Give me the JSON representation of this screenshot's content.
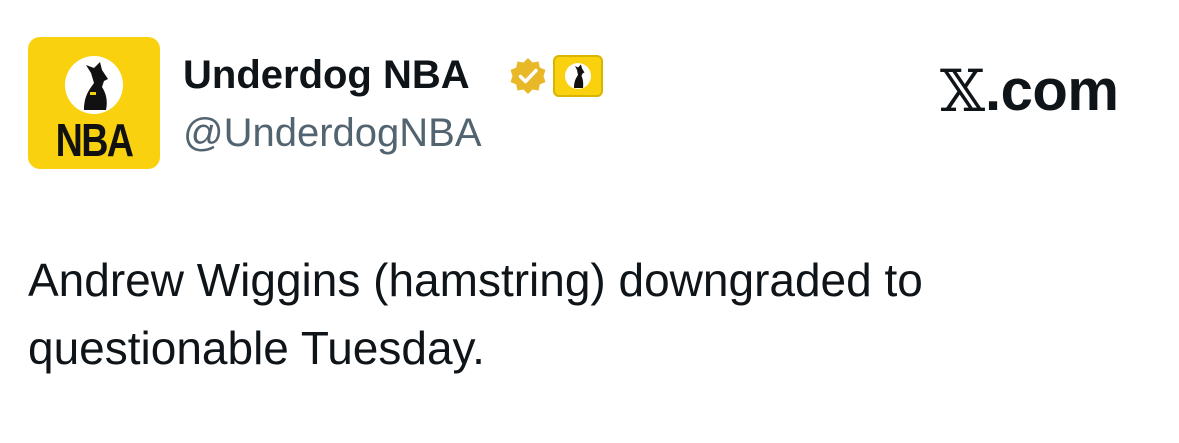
{
  "author": {
    "avatar_text": "NBA",
    "display_name": "Underdog NBA",
    "handle": "@UnderdogNBA",
    "verified_badge": "gold-check-badge-icon",
    "affiliate_badge": "underdog-dog-icon"
  },
  "brand": {
    "logo_x": "𝕏",
    "logo_suffix": ".com"
  },
  "tweet": {
    "lines": [
      "Andrew Wiggins (hamstring) downgraded to",
      "questionable Tuesday."
    ]
  },
  "colors": {
    "avatar_yellow": "#f9d10f",
    "verified_gold": "#e8b829",
    "text_primary": "#0f1419",
    "text_secondary": "#536471"
  }
}
